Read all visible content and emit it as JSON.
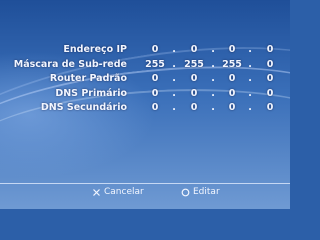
{
  "network_settings": {
    "rows": [
      {
        "label": "Endereço IP",
        "octets": [
          "0",
          "0",
          "0",
          "0"
        ]
      },
      {
        "label": "Máscara de Sub-rede",
        "octets": [
          "255",
          "255",
          "255",
          "0"
        ]
      },
      {
        "label": "Router Padrão",
        "octets": [
          "0",
          "0",
          "0",
          "0"
        ]
      },
      {
        "label": "DNS Primário",
        "octets": [
          "0",
          "0",
          "0",
          "0"
        ]
      },
      {
        "label": "DNS Secundário",
        "octets": [
          "0",
          "0",
          "0",
          "0"
        ]
      }
    ],
    "separator": "."
  },
  "footer": {
    "cancel_label": "Cancelar",
    "cancel_icon": "cross-icon",
    "edit_label": "Editar",
    "edit_icon": "circle-icon"
  },
  "colors": {
    "text": "#f2f6ff",
    "background_top": "#1f4f99",
    "background_bottom": "#6f9ad3"
  }
}
